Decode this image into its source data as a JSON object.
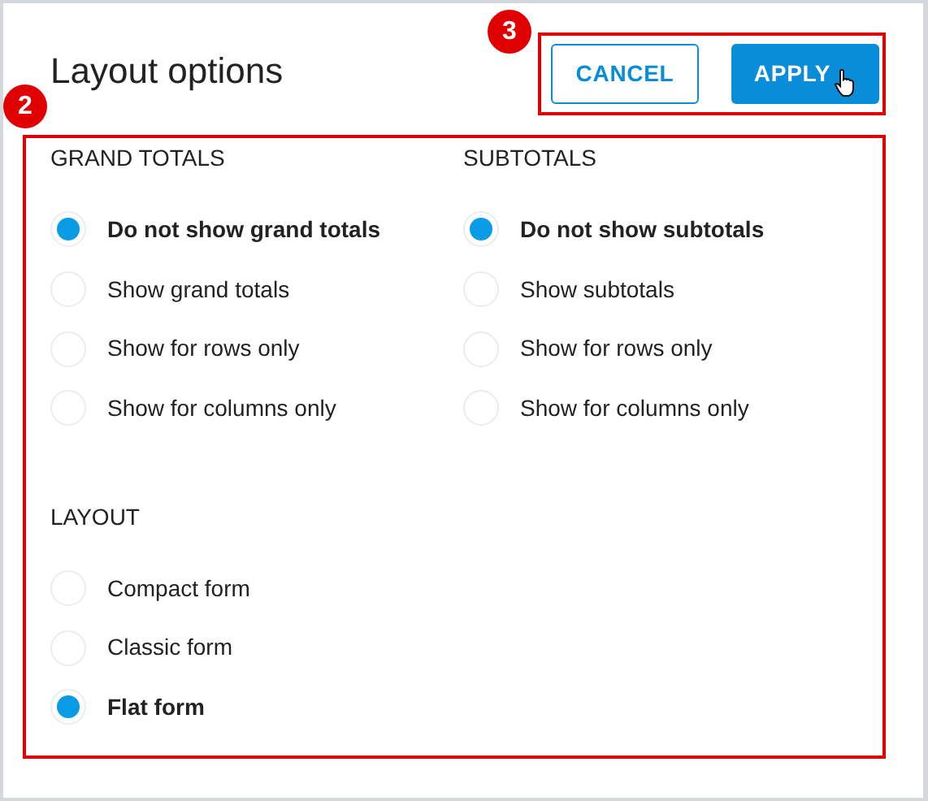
{
  "title": "Layout options",
  "buttons": [
    {
      "label": "CANCEL",
      "kind": "outline"
    },
    {
      "label": "APPLY",
      "kind": "primary"
    }
  ],
  "annotations": [
    {
      "label": "2"
    },
    {
      "label": "3"
    }
  ],
  "groups": [
    {
      "heading": "GRAND TOTALS",
      "options": [
        {
          "label": "Do not show grand totals",
          "selected": true
        },
        {
          "label": "Show grand totals",
          "selected": false
        },
        {
          "label": "Show for rows only",
          "selected": false
        },
        {
          "label": "Show for columns only",
          "selected": false
        }
      ]
    },
    {
      "heading": "SUBTOTALS",
      "options": [
        {
          "label": "Do not show subtotals",
          "selected": true
        },
        {
          "label": "Show subtotals",
          "selected": false
        },
        {
          "label": "Show for rows only",
          "selected": false
        },
        {
          "label": "Show for columns only",
          "selected": false
        }
      ]
    },
    {
      "heading": "LAYOUT",
      "options": [
        {
          "label": "Compact form",
          "selected": false
        },
        {
          "label": "Classic form",
          "selected": false
        },
        {
          "label": "Flat form",
          "selected": true
        }
      ]
    }
  ]
}
